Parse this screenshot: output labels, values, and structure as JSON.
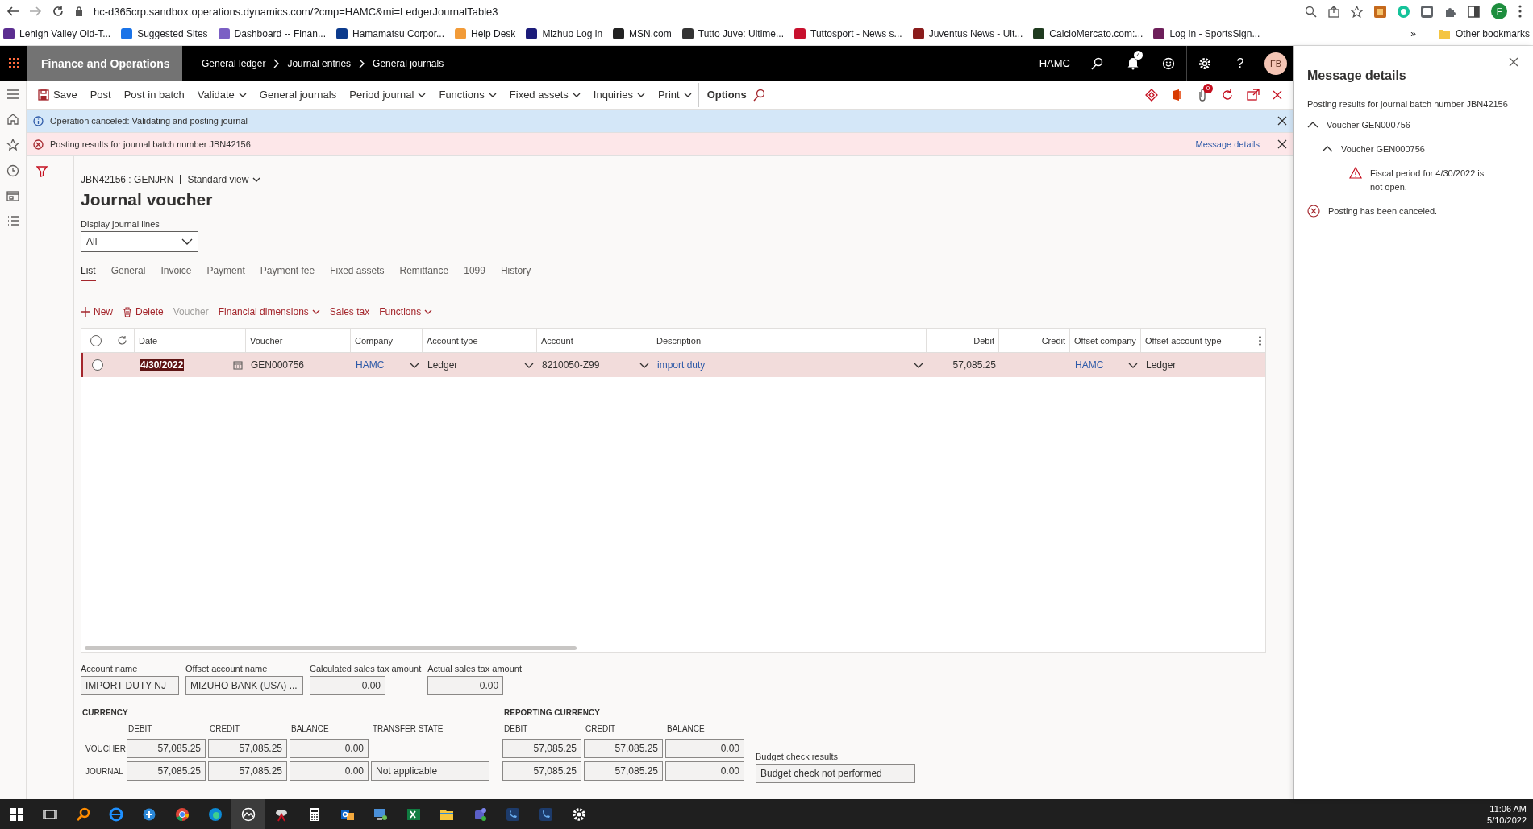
{
  "browser": {
    "url": "hc-d365crp.sandbox.operations.dynamics.com/?cmp=HAMC&mi=LedgerJournalTable3",
    "profile": "F",
    "bookmarks": [
      {
        "label": "Lehigh Valley Old-T...",
        "color": "#5b2d90"
      },
      {
        "label": "Suggested Sites",
        "color": "#1a73e8"
      },
      {
        "label": "Dashboard -- Finan...",
        "color": "#7b5fc4"
      },
      {
        "label": "Hamamatsu Corpor...",
        "color": "#0b3a8c"
      },
      {
        "label": "Help Desk",
        "color": "#f29b38"
      },
      {
        "label": "Mizhuo Log in",
        "color": "#1c1c7a"
      },
      {
        "label": "MSN.com",
        "color": "#222222"
      },
      {
        "label": "Tutto Juve: Ultime...",
        "color": "#333333"
      },
      {
        "label": "Tuttosport - News s...",
        "color": "#c8102e"
      },
      {
        "label": "Juventus News - Ult...",
        "color": "#8a1c1c"
      },
      {
        "label": "CalcioMercato.com:...",
        "color": "#1f3b1f"
      },
      {
        "label": "Log in - SportsSign...",
        "color": "#6d1f5a"
      }
    ],
    "overflow": "»",
    "other_bookmarks": "Other bookmarks"
  },
  "header": {
    "product": "Finance and Operations",
    "breadcrumbs": [
      "General ledger",
      "Journal entries",
      "General journals"
    ],
    "company": "HAMC",
    "notifications": "4",
    "help": "?",
    "user": "FB"
  },
  "toolbar": {
    "items": [
      {
        "label": "Save",
        "kind": "save"
      },
      {
        "label": "Post",
        "kind": "button"
      },
      {
        "label": "Post in batch",
        "kind": "button"
      },
      {
        "label": "Validate",
        "kind": "menu"
      },
      {
        "label": "General journals",
        "kind": "button"
      },
      {
        "label": "Period journal",
        "kind": "menu"
      },
      {
        "label": "Functions",
        "kind": "menu"
      },
      {
        "label": "Fixed assets",
        "kind": "menu"
      },
      {
        "label": "Inquiries",
        "kind": "menu"
      },
      {
        "label": "Print",
        "kind": "menu"
      },
      {
        "label": "Options",
        "kind": "tab"
      }
    ],
    "attachments": "0"
  },
  "messages": [
    {
      "kind": "info",
      "text": "Operation canceled: Validating and posting journal"
    },
    {
      "kind": "error",
      "text": "Posting results for journal batch number JBN42156",
      "link": "Message details"
    }
  ],
  "page": {
    "caption": "JBN42156 : GENJRN",
    "view": "Standard view",
    "title": "Journal voucher",
    "display_lines": {
      "label": "Display journal lines",
      "value": "All"
    },
    "tabs": [
      {
        "label": "List",
        "selected": true
      },
      {
        "label": "General",
        "selected": false
      },
      {
        "label": "Invoice",
        "selected": false
      },
      {
        "label": "Payment",
        "selected": false
      },
      {
        "label": "Payment fee",
        "selected": false
      },
      {
        "label": "Fixed assets",
        "selected": false
      },
      {
        "label": "Remittance",
        "selected": false
      },
      {
        "label": "1099",
        "selected": false
      },
      {
        "label": "History",
        "selected": false
      }
    ],
    "actions": [
      {
        "label": "New",
        "kind": "add",
        "disabled": false
      },
      {
        "label": "Delete",
        "kind": "delete",
        "disabled": false
      },
      {
        "label": "Voucher",
        "kind": "button",
        "disabled": true
      },
      {
        "label": "Financial dimensions",
        "kind": "menu",
        "disabled": false
      },
      {
        "label": "Sales tax",
        "kind": "button",
        "disabled": false
      },
      {
        "label": "Functions",
        "kind": "menu",
        "disabled": false
      }
    ]
  },
  "grid": {
    "select_all": {
      "checked": false
    },
    "columns": [
      {
        "label": "Date",
        "kind": "text"
      },
      {
        "label": "Voucher",
        "kind": "text"
      },
      {
        "label": "Company",
        "kind": "text"
      },
      {
        "label": "Account type",
        "kind": "text"
      },
      {
        "label": "Account",
        "kind": "text"
      },
      {
        "label": "Description",
        "kind": "text"
      },
      {
        "label": "Debit",
        "kind": "number"
      },
      {
        "label": "Credit",
        "kind": "number"
      },
      {
        "label": "Offset company",
        "kind": "text"
      },
      {
        "label": "Offset account type",
        "kind": "text"
      }
    ],
    "rows": [
      {
        "selected": true,
        "checked": false,
        "cells": [
          {
            "kind": "date",
            "text": "4/30/2022",
            "focused": true
          },
          {
            "kind": "text",
            "text": "GEN000756"
          },
          {
            "kind": "link-lookup",
            "text": "HAMC"
          },
          {
            "kind": "lookup",
            "text": "Ledger"
          },
          {
            "kind": "lookup",
            "text": "8210050-Z99"
          },
          {
            "kind": "link-lookup",
            "text": "import duty"
          },
          {
            "kind": "number",
            "text": "57,085.25"
          },
          {
            "kind": "empty"
          },
          {
            "kind": "link-lookup",
            "text": "HAMC"
          },
          {
            "kind": "text",
            "text": "Ledger"
          }
        ]
      }
    ]
  },
  "summary": {
    "fields": [
      {
        "label": "Account name",
        "value": "IMPORT DUTY NJ",
        "kind": "text"
      },
      {
        "label": "Offset account name",
        "value": "MIZUHO BANK (USA) ...",
        "kind": "text"
      },
      {
        "label": "Calculated sales tax amount",
        "value": "0.00",
        "kind": "number"
      },
      {
        "label": "Actual sales tax amount",
        "value": "0.00",
        "kind": "number"
      }
    ],
    "currency": {
      "title": "CURRENCY",
      "columns": [
        "DEBIT",
        "CREDIT",
        "BALANCE",
        "TRANSFER STATE"
      ],
      "rows": [
        {
          "label": "VOUCHER",
          "values": [
            "57,085.25",
            "57,085.25",
            "0.00"
          ]
        },
        {
          "label": "JOURNAL",
          "values": [
            "57,085.25",
            "57,085.25",
            "0.00",
            "Not applicable"
          ]
        }
      ]
    },
    "reporting": {
      "title": "REPORTING CURRENCY",
      "columns": [
        "DEBIT",
        "CREDIT",
        "BALANCE"
      ],
      "rows": [
        {
          "values": [
            "57,085.25",
            "57,085.25",
            "0.00"
          ]
        },
        {
          "values": [
            "57,085.25",
            "57,085.25",
            "0.00"
          ]
        }
      ]
    },
    "budget": {
      "label": "Budget check results",
      "value": "Budget check not performed"
    }
  },
  "message_panel": {
    "title": "Message details",
    "intro": "Posting results for journal batch number JBN42156",
    "items": [
      {
        "kind": "group",
        "label": "Voucher GEN000756",
        "expanded": true,
        "children": [
          {
            "kind": "group",
            "label": "Voucher GEN000756",
            "expanded": true,
            "children": [
              {
                "kind": "warning",
                "label": "Fiscal period for 4/30/2022 is not open."
              }
            ]
          }
        ]
      },
      {
        "kind": "error",
        "label": "Posting has been canceled."
      }
    ]
  },
  "taskbar": {
    "apps": [
      {
        "selected": false
      },
      {
        "selected": false
      },
      {
        "selected": false
      },
      {
        "selected": false
      },
      {
        "selected": false
      },
      {
        "selected": false
      },
      {
        "selected": false
      },
      {
        "selected": true
      },
      {
        "selected": false
      },
      {
        "selected": false
      },
      {
        "selected": false
      },
      {
        "selected": false
      },
      {
        "selected": false
      },
      {
        "selected": false
      },
      {
        "selected": false
      },
      {
        "selected": false
      },
      {
        "selected": false
      },
      {
        "selected": false
      }
    ],
    "time": "11:06 AM",
    "date": "5/10/2022"
  }
}
